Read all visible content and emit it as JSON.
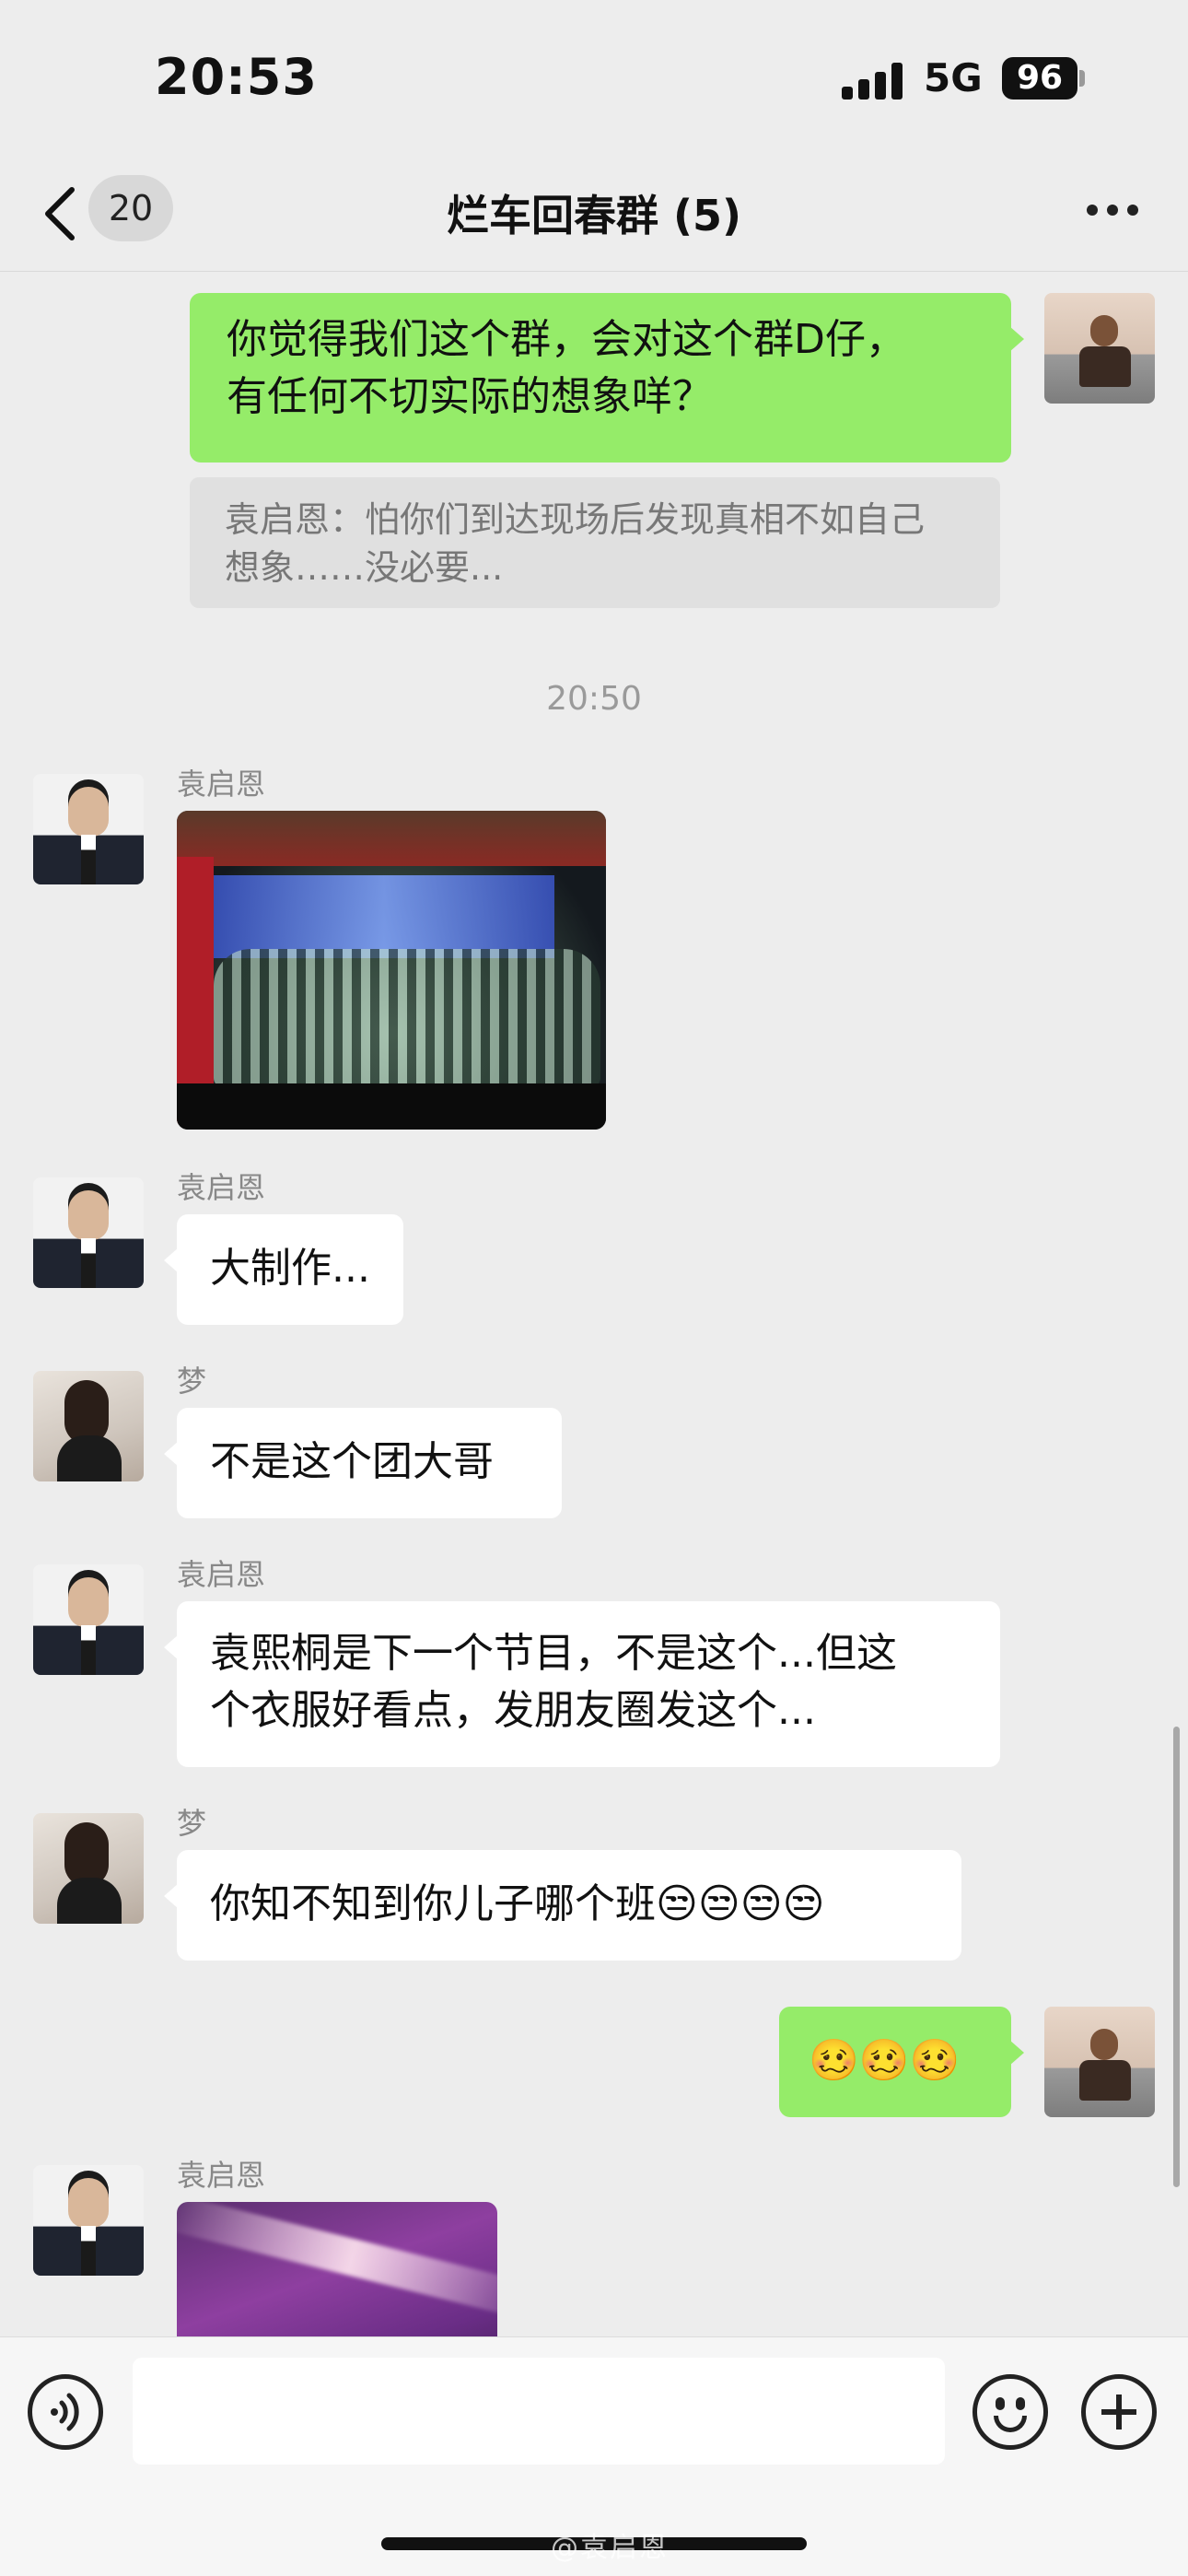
{
  "status_bar": {
    "time": "20:53",
    "network": "5G",
    "battery": "96"
  },
  "nav": {
    "back_badge": "20",
    "title": "烂车回春群 (5)"
  },
  "messages": {
    "m1": {
      "side": "right",
      "text": "你觉得我们这个群，会对这个群D仔，有任何不切实际的想象咩？",
      "line1": "你觉得我们这个群，会对这个群D仔，",
      "line2": "有任何不切实际的想象咩？"
    },
    "quote": {
      "line1": "袁启恩：怕你们到达现场后发现真相不如自己",
      "line2": "想象……没必要..."
    },
    "time_sep": "20:50",
    "m2": {
      "sender": "袁启恩",
      "type": "image",
      "image_desc": "stage-orchestra-photo"
    },
    "m3": {
      "sender": "袁启恩",
      "text": "大制作..."
    },
    "m4": {
      "sender": "梦",
      "text": "不是这个团大哥"
    },
    "m5": {
      "sender": "袁启恩",
      "line1": "袁熙桐是下一个节目，不是这个...但这",
      "line2": "个衣服好看点，发朋友圈发这个..."
    },
    "m6": {
      "sender": "梦",
      "text": "你知不知到你儿子哪个班😒😒😒😒"
    },
    "m7": {
      "side": "right",
      "text": "🥴🥴🥴"
    },
    "m8": {
      "sender": "袁启恩",
      "type": "image",
      "image_desc": "purple-sparkle-photo"
    }
  },
  "input_bar": {
    "placeholder": ""
  },
  "watermark": "@袁启恩",
  "colors": {
    "background": "#ededed",
    "bubble_green": "#95ec69",
    "bubble_white": "#ffffff"
  },
  "icons": [
    "back-icon",
    "more-icon",
    "voice-icon",
    "emoji-icon",
    "plus-icon",
    "signal-icon",
    "battery-icon"
  ]
}
